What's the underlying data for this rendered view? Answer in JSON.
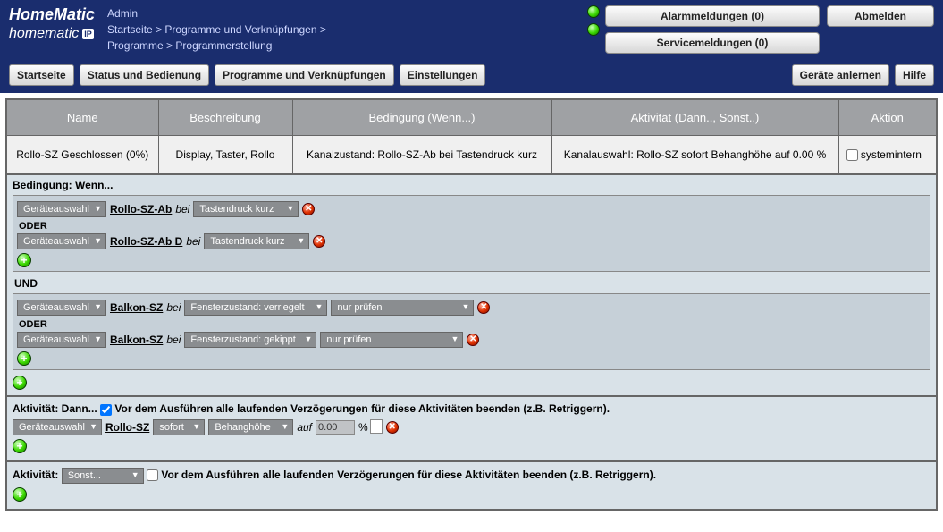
{
  "header": {
    "logo1": "HomeMatic",
    "logo2": "homematic",
    "ip": "IP",
    "user": "Admin",
    "bc1": "Startseite",
    "bc_sep": " > ",
    "bc2": "Programme und Verknüpfungen",
    "bc3": "Programme",
    "bc4": "Programmerstellung",
    "alarm": "Alarmmeldungen (0)",
    "logout": "Abmelden",
    "service": "Servicemeldungen (0)"
  },
  "nav": {
    "home": "Startseite",
    "status": "Status und Bedienung",
    "prog": "Programme und Verknüpfungen",
    "settings": "Einstellungen",
    "learn": "Geräte anlernen",
    "help": "Hilfe"
  },
  "cols": {
    "name": "Name",
    "desc": "Beschreibung",
    "cond": "Bedingung (Wenn...)",
    "act": "Aktivität (Dann.., Sonst..)",
    "aktion": "Aktion"
  },
  "row": {
    "name": "Rollo-SZ Geschlossen (0%)",
    "desc": "Display, Taster, Rollo",
    "cond": "Kanalzustand: Rollo-SZ-Ab bei Tastendruck kurz",
    "act": "Kanalauswahl: Rollo-SZ sofort Behanghöhe auf 0.00 %",
    "sysintern": "systemintern"
  },
  "cond": {
    "title": "Bedingung: Wenn...",
    "device_select": "Geräteauswahl",
    "dev1": "Rollo-SZ-Ab",
    "bei": "bei",
    "trig1": "Tastendruck kurz",
    "oder": "ODER",
    "dev2": "Rollo-SZ-Ab D",
    "und": "UND",
    "dev3": "Balkon-SZ",
    "state1": "Fensterzustand: verriegelt",
    "check": "nur prüfen",
    "state2": "Fensterzustand: gekippt"
  },
  "dann": {
    "title": "Aktivität: Dann...",
    "retrigger": "Vor dem Ausführen alle laufenden Verzögerungen für diese Aktivitäten beenden (z.B. Retriggern).",
    "dev": "Rollo-SZ",
    "sofort": "sofort",
    "behang": "Behanghöhe",
    "auf": "auf",
    "val": "0.00",
    "pct": "%"
  },
  "sonst": {
    "title": "Aktivität:",
    "select": "Sonst...",
    "retrigger": "Vor dem Ausführen alle laufenden Verzögerungen für diese Aktivitäten beenden (z.B. Retriggern)."
  }
}
